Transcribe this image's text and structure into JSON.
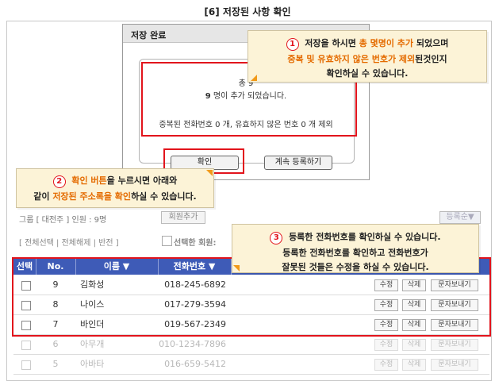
{
  "page_heading": "[6] 저장된 사항 확인",
  "colors": {
    "accent_red": "#e2141c",
    "header_blue": "#3e5bb7",
    "highlight_orange": "#e46b00",
    "callout_bg": "#fcf3d7"
  },
  "background": {
    "group_label": "그룹 [ 대전주 ]  인원 : 9명",
    "group_button": "회원추가",
    "sort_dropdown": "등록순▼",
    "select_links": "[ 전체선택 | 전체해제 | 반전 ]",
    "selected_label": "선택한 회원:"
  },
  "dialog": {
    "title": "저장 완료",
    "line1": "총 9",
    "line2_num": "9",
    "line2_text": " 명이 추가 되었습니다.",
    "line3": "중복된 전화번호 0 개, 유효하지 않은 번호 0 개 제외",
    "confirm_label": "확인",
    "continue_label": "계속 등록하기"
  },
  "callouts": [
    {
      "num": "1",
      "l1a": "저장을 하시면 ",
      "l1b": "총 몇명이 추가",
      "l1c": " 되었으며",
      "l2a": "중복 및 유효하지 않은 번호가 제외",
      "l2b": "된것인지",
      "l3": "확인하실 수 있습니다."
    },
    {
      "num": "2",
      "l1a": "확인 버튼",
      "l1b": "을 누르시면 아래와",
      "l2a": "같이 ",
      "l2b": "저장된 주소록을 확인",
      "l2c": "하실 수 있습니다."
    },
    {
      "num": "3",
      "l1": "등록한 전화번호를 확인하실 수 있습니다.",
      "l2": "등록한 전화번호를 확인하고 전화번호가",
      "l3": "잘못된 것들은 수정을 하실 수 있습니다."
    }
  ],
  "table": {
    "headers": {
      "select": "선택",
      "no": "No.",
      "name": "이름 ▼",
      "phone": "전화번호 ▼"
    },
    "actions": {
      "edit": "수정",
      "delete": "삭제",
      "sms": "문자보내기"
    },
    "rows": [
      {
        "no": "9",
        "name": "김화성",
        "phone": "018-245-6892"
      },
      {
        "no": "8",
        "name": "나이스",
        "phone": "017-279-3594"
      },
      {
        "no": "7",
        "name": "바인더",
        "phone": "019-567-2349"
      },
      {
        "no": "6",
        "name": "아무개",
        "phone": "010-1234-7896"
      },
      {
        "no": "5",
        "name": "아바타",
        "phone": "016-659-5412"
      }
    ]
  }
}
